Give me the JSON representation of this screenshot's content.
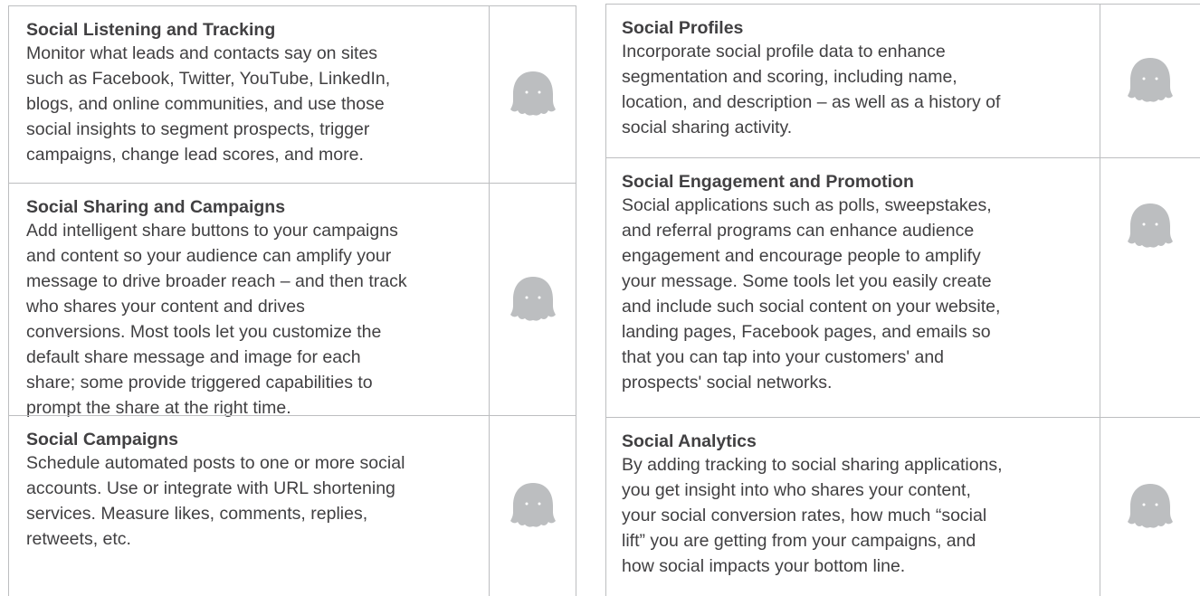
{
  "left_column": [
    {
      "title": "Social Listening and Tracking",
      "desc": "Monitor what leads and contacts say on sites\nsuch as Facebook, Twitter, YouTube, LinkedIn,\nblogs, and online communities, and use those\nsocial insights to segment prospects, trigger\ncampaigns, change lead scores, and more.",
      "icon": "ghost-icon"
    },
    {
      "title": "Social Sharing and Campaigns",
      "desc": "Add intelligent share buttons to your campaigns\nand content so your audience can amplify your\nmessage to drive broader reach – and then track\nwho shares your content and drives\nconversions. Most tools let you customize the\ndefault share message and image for each\nshare; some provide triggered capabilities to\nprompt the share at the right time.",
      "icon": "ghost-icon"
    },
    {
      "title": "Social Campaigns",
      "desc": "Schedule automated posts to one or more social\naccounts. Use or integrate with URL shortening\nservices. Measure likes, comments, replies,\nretweets, etc.",
      "icon": "ghost-icon"
    }
  ],
  "right_column": [
    {
      "title": "Social Profiles",
      "desc": "Incorporate social profile data to enhance\nsegmentation and scoring, including name,\nlocation, and description – as well as a history of\nsocial sharing activity.",
      "icon": "ghost-icon"
    },
    {
      "title": "Social Engagement and Promotion",
      "desc": "Social applications such as polls, sweepstakes,\nand referral programs can enhance audience\nengagement and encourage people to amplify\nyour message. Some tools let you easily create\nand include such social content on your website,\nlanding pages, Facebook pages, and emails so\nthat you can tap into your customers' and\nprospects' social networks.",
      "icon": "ghost-icon"
    },
    {
      "title": "Social Analytics",
      "desc": "By adding tracking to social sharing applications,\nyou get insight into who shares your content,\nyour social conversion rates, how much “social\nlift” you are getting from your campaigns, and\nhow social impacts your bottom line.",
      "icon": "ghost-icon"
    }
  ],
  "colors": {
    "border": "#bdbec0",
    "text": "#414042",
    "icon": "#bcbec0"
  }
}
